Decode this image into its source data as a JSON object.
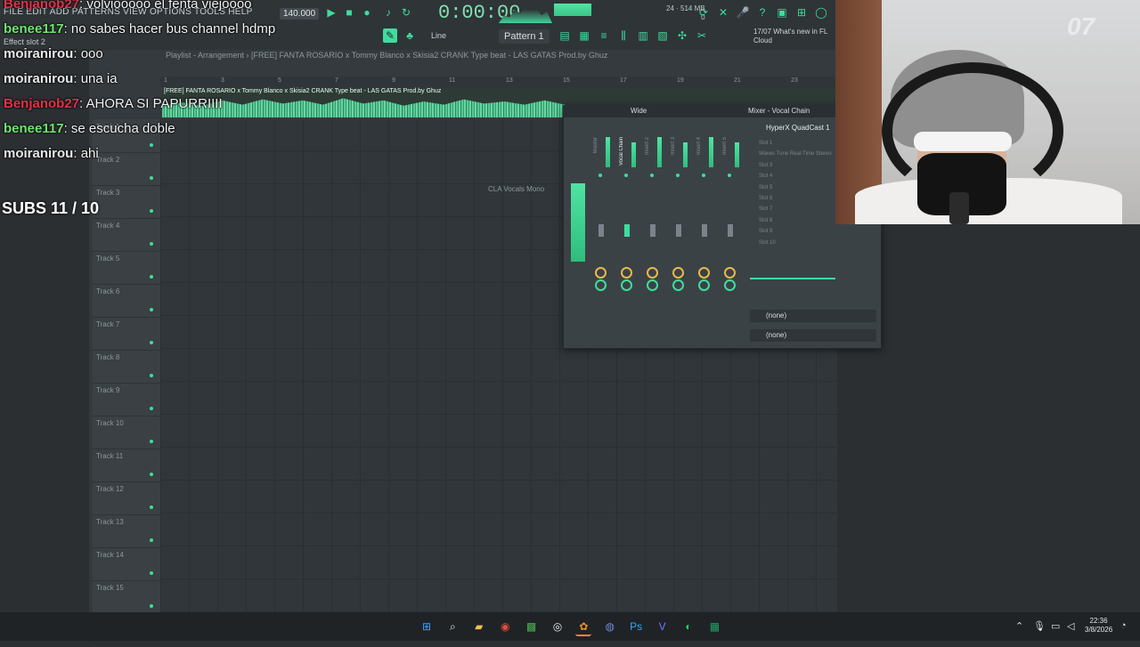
{
  "menu": "FILE EDIT ADD PATTERNS VIEW OPTIONS TOOLS HELP",
  "effect_slot": "Effect slot 2",
  "transport": {
    "time": "0:00:00",
    "bpm": "140.000",
    "mem_top": "514 MB",
    "mem_val": "24",
    "mem_small": "0"
  },
  "toolbar": {
    "line_mode": "Line",
    "pattern": "Pattern 1",
    "news": "17/07  What's new in FL Cloud"
  },
  "playlist": {
    "title": "Playlist - Arrangement › [FREE] FANTA ROSARIO x Tommy Blanco x Skisia2 CRANK Type beat - LAS GATAS  Prod.by Ghuz",
    "clip_label": "[FREE] FANTA ROSARIO x Tommy Blanco x Skisia2 CRANK Type beat - LAS GATAS  Prod.by Ghuz",
    "ruler": [
      "1",
      "3",
      "5",
      "7",
      "9",
      "11",
      "13",
      "15",
      "17",
      "19",
      "21",
      "23"
    ],
    "tracks": [
      "Track 1",
      "Track 2",
      "Track 3",
      "Track 4",
      "Track 5",
      "Track 6",
      "Track 7",
      "Track 8",
      "Track 9",
      "Track 10",
      "Track 11",
      "Track 12",
      "Track 13",
      "Track 14",
      "Track 15",
      "Track 16"
    ]
  },
  "chat": [
    {
      "user": "Benjanob27",
      "msg": "volviooooo el fenta viejoooo",
      "color": "red"
    },
    {
      "user": "benee117",
      "msg": "no sabes hacer bus channel hdmp",
      "color": "green"
    },
    {
      "user": "moiranirou",
      "msg": "ooo",
      "color": "white"
    },
    {
      "user": "moiranirou",
      "msg": "una ia",
      "color": "white"
    },
    {
      "user": "Benjanob27",
      "msg": "AHORA SI PAPURRIIII",
      "color": "red"
    },
    {
      "user": "benee117",
      "msg": "se escucha doble",
      "color": "green"
    },
    {
      "user": "moiranirou",
      "msg": "ahi",
      "color": "white"
    }
  ],
  "subs": "SUBS 11 / 10",
  "mixer": {
    "mode": "Wide",
    "title": "Mixer - Vocal Chain",
    "device": "HyperX QuadCast 1",
    "slots": [
      "Slot 1",
      "Waves Tune Real-Time Stereo",
      "Slot 3",
      "Slot 4",
      "Slot 5",
      "Slot 6",
      "Slot 7",
      "Slot 8",
      "Slot 9",
      "Slot 10"
    ],
    "strips": [
      "Master",
      "Vocal Chain",
      "Insert 2",
      "Insert 3",
      "Insert 4",
      "Insert 5"
    ],
    "route_in": "(none)",
    "route_out": "(none)",
    "cla": "CLA Vocals Mono"
  },
  "webcam": {
    "deco": "07"
  },
  "taskbar": {
    "icons": [
      "windows-icon",
      "search-icon",
      "file-explorer-icon",
      "chrome-icon",
      "minecraft-icon",
      "obs-icon",
      "fl-studio-icon",
      "discord-icon",
      "photoshop-icon",
      "vegas-icon",
      "spotify-icon",
      "excel-icon"
    ],
    "time": "22:36",
    "date": "3/8/2026"
  },
  "colors": {
    "accent": "#3fdc9f",
    "chat_red": "#e0334a",
    "chat_green": "#6fe66f"
  }
}
